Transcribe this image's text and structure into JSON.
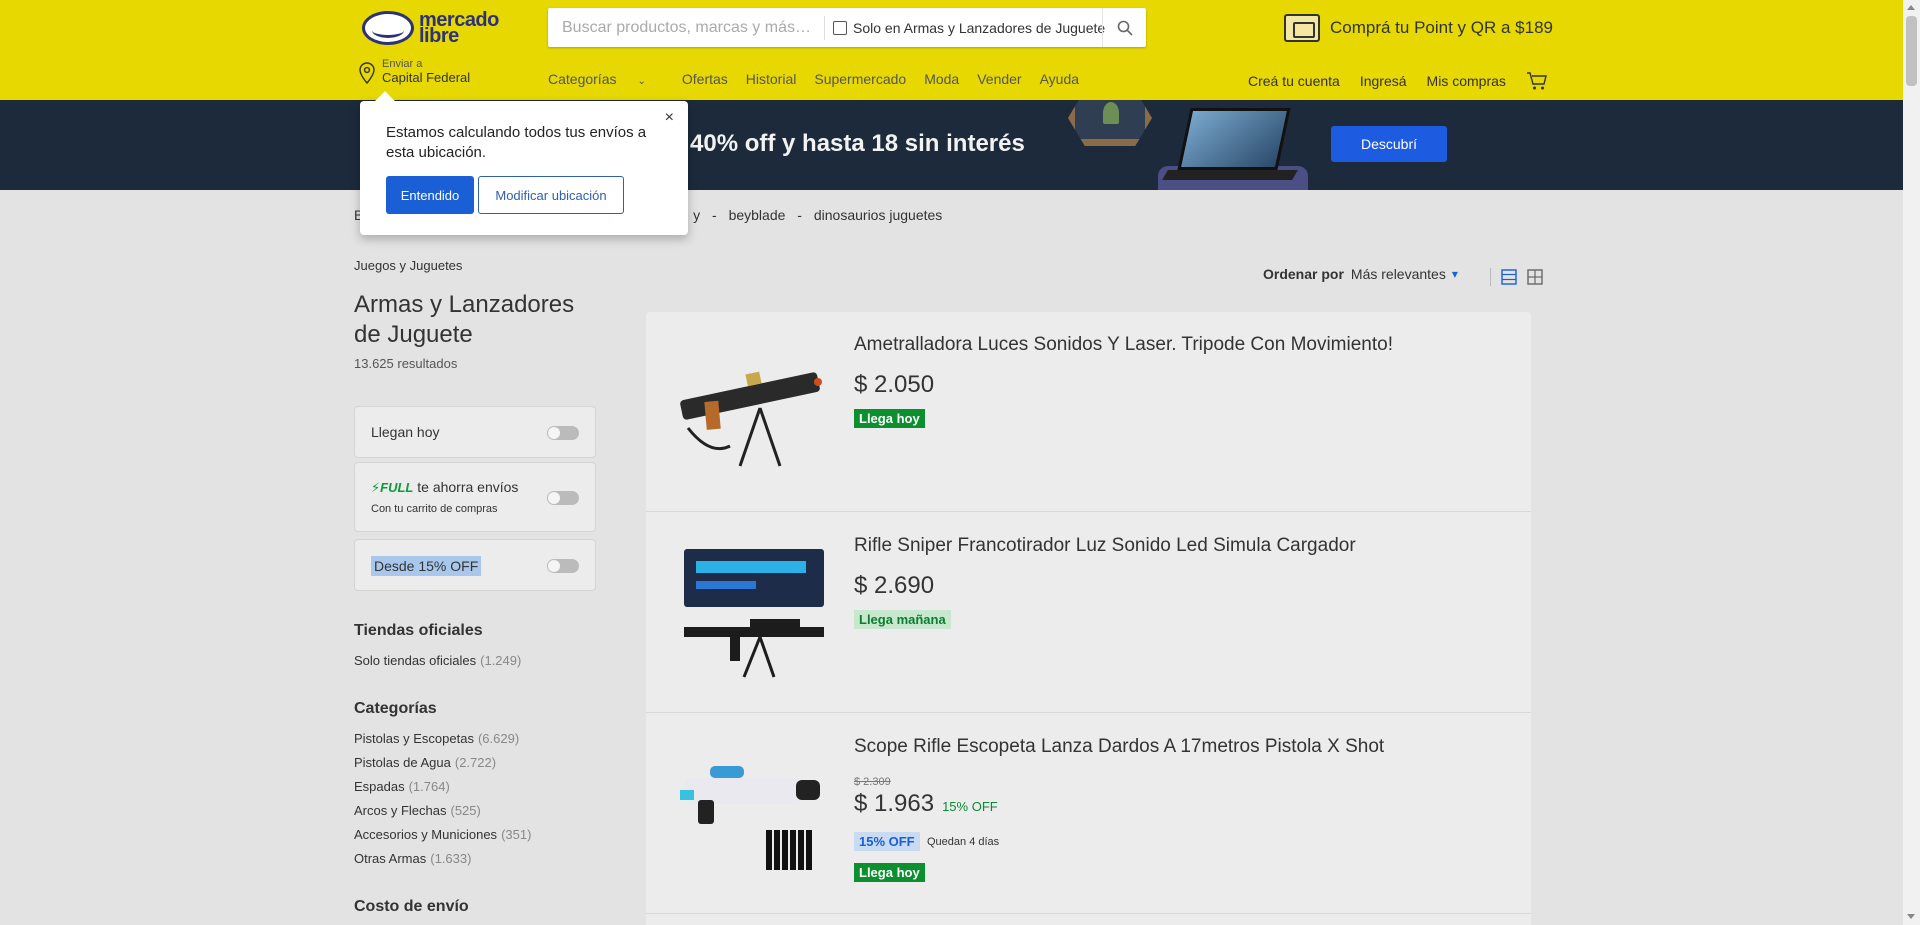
{
  "header": {
    "logo_line1": "mercado",
    "logo_line2": "libre",
    "search_placeholder": "Buscar productos, marcas y más…",
    "search_filter_label": "Solo en Armas y Lanzadores de Juguete",
    "promo_text": "Comprá tu Point y QR a $189",
    "location_label": "Enviar a",
    "location_value": "Capital Federal",
    "nav": [
      "Categorías",
      "Ofertas",
      "Historial",
      "Supermercado",
      "Moda",
      "Vender",
      "Ayuda"
    ],
    "account": [
      "Creá tu cuenta",
      "Ingresá",
      "Mis compras"
    ]
  },
  "banner": {
    "text": "a 40% off y hasta 18 sin interés",
    "button": "Descubrí"
  },
  "breadcrumb": {
    "first_letter": "B",
    "tail": "y",
    "items": [
      "beyblade",
      "dinosaurios juguetes"
    ],
    "separator": "-"
  },
  "popup": {
    "text": "Estamos calculando todos tus envíos a esta ubicación.",
    "close": "×",
    "primary": "Entendido",
    "secondary": "Modificar ubicación"
  },
  "sidebar": {
    "category": "Juegos y Juguetes",
    "title": "Armas y Lanzadores de Juguete",
    "results": "13.625 resultados",
    "filter_today": "Llegan hoy",
    "full_brand": "FULL",
    "full_text": "te ahorra envíos",
    "full_sub": "Con tu carrito de compras",
    "discount_tag": "Desde 15% OFF",
    "official_title": "Tiendas oficiales",
    "official_link": "Solo tiendas oficiales",
    "official_count": "(1.249)",
    "categories_title": "Categorías",
    "categories": [
      {
        "name": "Pistolas y Escopetas",
        "count": "(6.629)"
      },
      {
        "name": "Pistolas de Agua",
        "count": "(2.722)"
      },
      {
        "name": "Espadas",
        "count": "(1.764)"
      },
      {
        "name": "Arcos y Flechas",
        "count": "(525)"
      },
      {
        "name": "Accesorios y Municiones",
        "count": "(351)"
      },
      {
        "name": "Otras Armas",
        "count": "(1.633)"
      }
    ],
    "shipping_title": "Costo de envío"
  },
  "sort": {
    "label": "Ordenar por",
    "value": "Más relevantes"
  },
  "items": [
    {
      "title": "Ametralladora Luces Sonidos Y Laser. Tripode Con Movimiento!",
      "price": "$ 2.050",
      "badge": "Llega hoy"
    },
    {
      "title": "Rifle Sniper Francotirador Luz Sonido Led Simula Cargador",
      "price": "$ 2.690",
      "badge": "Llega mañana"
    },
    {
      "title": "Scope Rifle Escopeta Lanza Dardos A 17metros Pistola X Shot",
      "old_price": "$ 2.309",
      "price": "$ 1.963",
      "off": "15% OFF",
      "off_tag": "15% OFF",
      "days": "Quedan 4 días",
      "badge": "Llega hoy"
    }
  ],
  "colors": {
    "header_bg": "#e6d800",
    "brand_blue": "#2d3277",
    "accent_blue": "#1a5fd6",
    "green": "#0b8f2f"
  }
}
